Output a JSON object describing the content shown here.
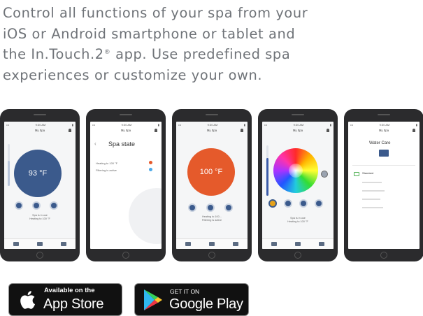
{
  "intro": {
    "line1": "Control all functions of your spa from your",
    "line2": "iOS or Android smartphone or tablet and",
    "line3_prefix": "the In.Touch.2",
    "line3_reg": "®",
    "line3_suffix": " app. Use predefined spa",
    "line4": "experiences or customize your own."
  },
  "phones": [
    {
      "screen": "my-spa-temperature",
      "nav_title": "My Spa",
      "temp": "93 °F",
      "caption1": "Spa is in use",
      "caption2": "Heating to 100 °F",
      "temp_level": 0.6
    },
    {
      "screen": "spa-state",
      "nav_title": "My Spa",
      "title": "Spa state",
      "row1": "Heating to 100 °F",
      "row2": "Filtering is active"
    },
    {
      "screen": "my-spa-heating",
      "nav_title": "My Spa",
      "temp": "100 °F",
      "caption1": "Heating to 100...",
      "caption2": "Filtering is active"
    },
    {
      "screen": "lights",
      "nav_title": "My Spa",
      "caption1": "Spa is in use",
      "caption2": "Heating to 100 °F",
      "brightness_level": 0.75
    },
    {
      "screen": "water-care",
      "nav_title": "My Spa",
      "title": "Water Care",
      "selected": "Standard"
    }
  ],
  "status_time": "9:30 AM",
  "app_store": {
    "small": "Available on the",
    "big": "App Store"
  },
  "google_play": {
    "small": "GET IT ON",
    "big": "Google Play"
  },
  "colors": {
    "spa_blue": "#3b5a8c",
    "heat_orange": "#e55a2b",
    "badge_bg": "#111111",
    "body_text": "#6f7378"
  },
  "icons": [
    "apple-logo-icon",
    "google-play-logo-icon"
  ]
}
